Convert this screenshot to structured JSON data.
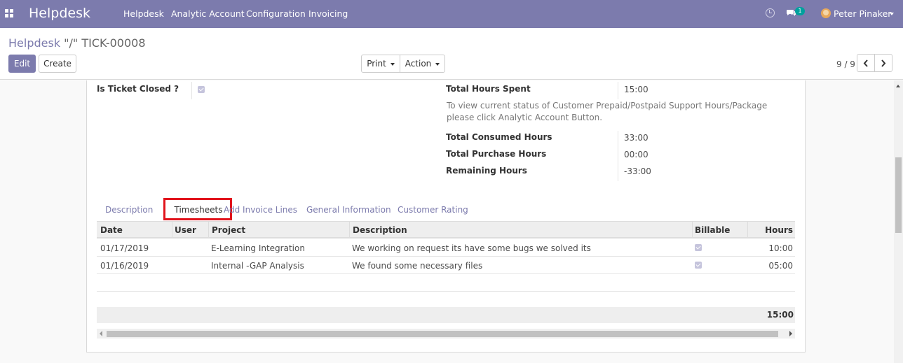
{
  "navbar": {
    "brand": "Helpdesk",
    "menu": [
      "Helpdesk",
      "Analytic Account",
      "Configuration",
      "Invoicing"
    ],
    "chat_badge": "1",
    "user_name": "Peter Pinaker",
    "icons": [
      "apps-grid-icon",
      "clock-icon",
      "chat-icon",
      "avatar"
    ]
  },
  "control_panel": {
    "breadcrumb_parent": "Helpdesk",
    "breadcrumb_current": "\"/\" TICK-00008",
    "edit_label": "Edit",
    "create_label": "Create",
    "print_label": "Print",
    "action_label": "Action",
    "pager": "9 / 9"
  },
  "form": {
    "is_closed_label": "Is Ticket Closed ?",
    "is_closed_value": true,
    "total_hours_spent_label": "Total Hours Spent",
    "total_hours_spent_value": "15:00",
    "help_text": "To view current status of Customer Prepaid/Postpaid Support Hours/Package please click Analytic Account Button.",
    "consumed_label": "Total Consumed Hours",
    "consumed_value": "33:00",
    "purchase_label": "Total Purchase Hours",
    "purchase_value": "00:00",
    "remaining_label": "Remaining Hours",
    "remaining_value": "-33:00"
  },
  "tabs": [
    "Description",
    "Timesheets",
    "Add Invoice Lines",
    "General Information",
    "Customer Rating"
  ],
  "active_tab": "Timesheets",
  "timesheets": {
    "headers": [
      "Date",
      "User",
      "Project",
      "Description",
      "Billable",
      "Hours"
    ],
    "rows": [
      {
        "date": "01/17/2019",
        "user": "",
        "project": "E-Learning Integration",
        "description": "We working on request its have some bugs we solved its",
        "billable": true,
        "hours": "10:00"
      },
      {
        "date": "01/16/2019",
        "user": "",
        "project": "Internal -GAP Analysis",
        "description": "We found some necessary files",
        "billable": true,
        "hours": "05:00"
      }
    ],
    "total": "15:00"
  },
  "colors": {
    "brand": "#7c7bad",
    "highlight": "#e1141c"
  }
}
